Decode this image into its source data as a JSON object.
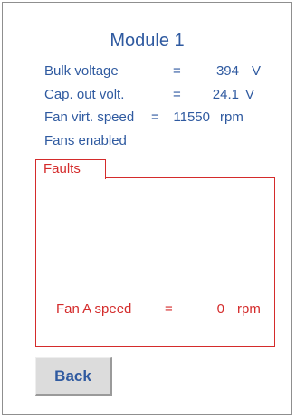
{
  "screen": {
    "title": "Module 1"
  },
  "readings": [
    {
      "label": "Bulk voltage",
      "eq": "=",
      "value": "394",
      "unit": "V"
    },
    {
      "label": "Cap. out volt.",
      "eq": "=",
      "value": "24.1",
      "unit": "V"
    },
    {
      "label": "Fan virt. speed",
      "eq": "=",
      "value": "11550",
      "unit": "rpm"
    }
  ],
  "status": {
    "fans_text": "Fans enabled"
  },
  "faults": {
    "tab_label": "Faults",
    "items": [
      {
        "label": "Fan A speed",
        "eq": "=",
        "value": "0",
        "unit": "rpm"
      }
    ]
  },
  "buttons": {
    "back_label": "Back"
  },
  "colors": {
    "text_blue": "#2f5aa0",
    "fault_red": "#d42b2b",
    "button_gray": "#dcdcdc"
  }
}
